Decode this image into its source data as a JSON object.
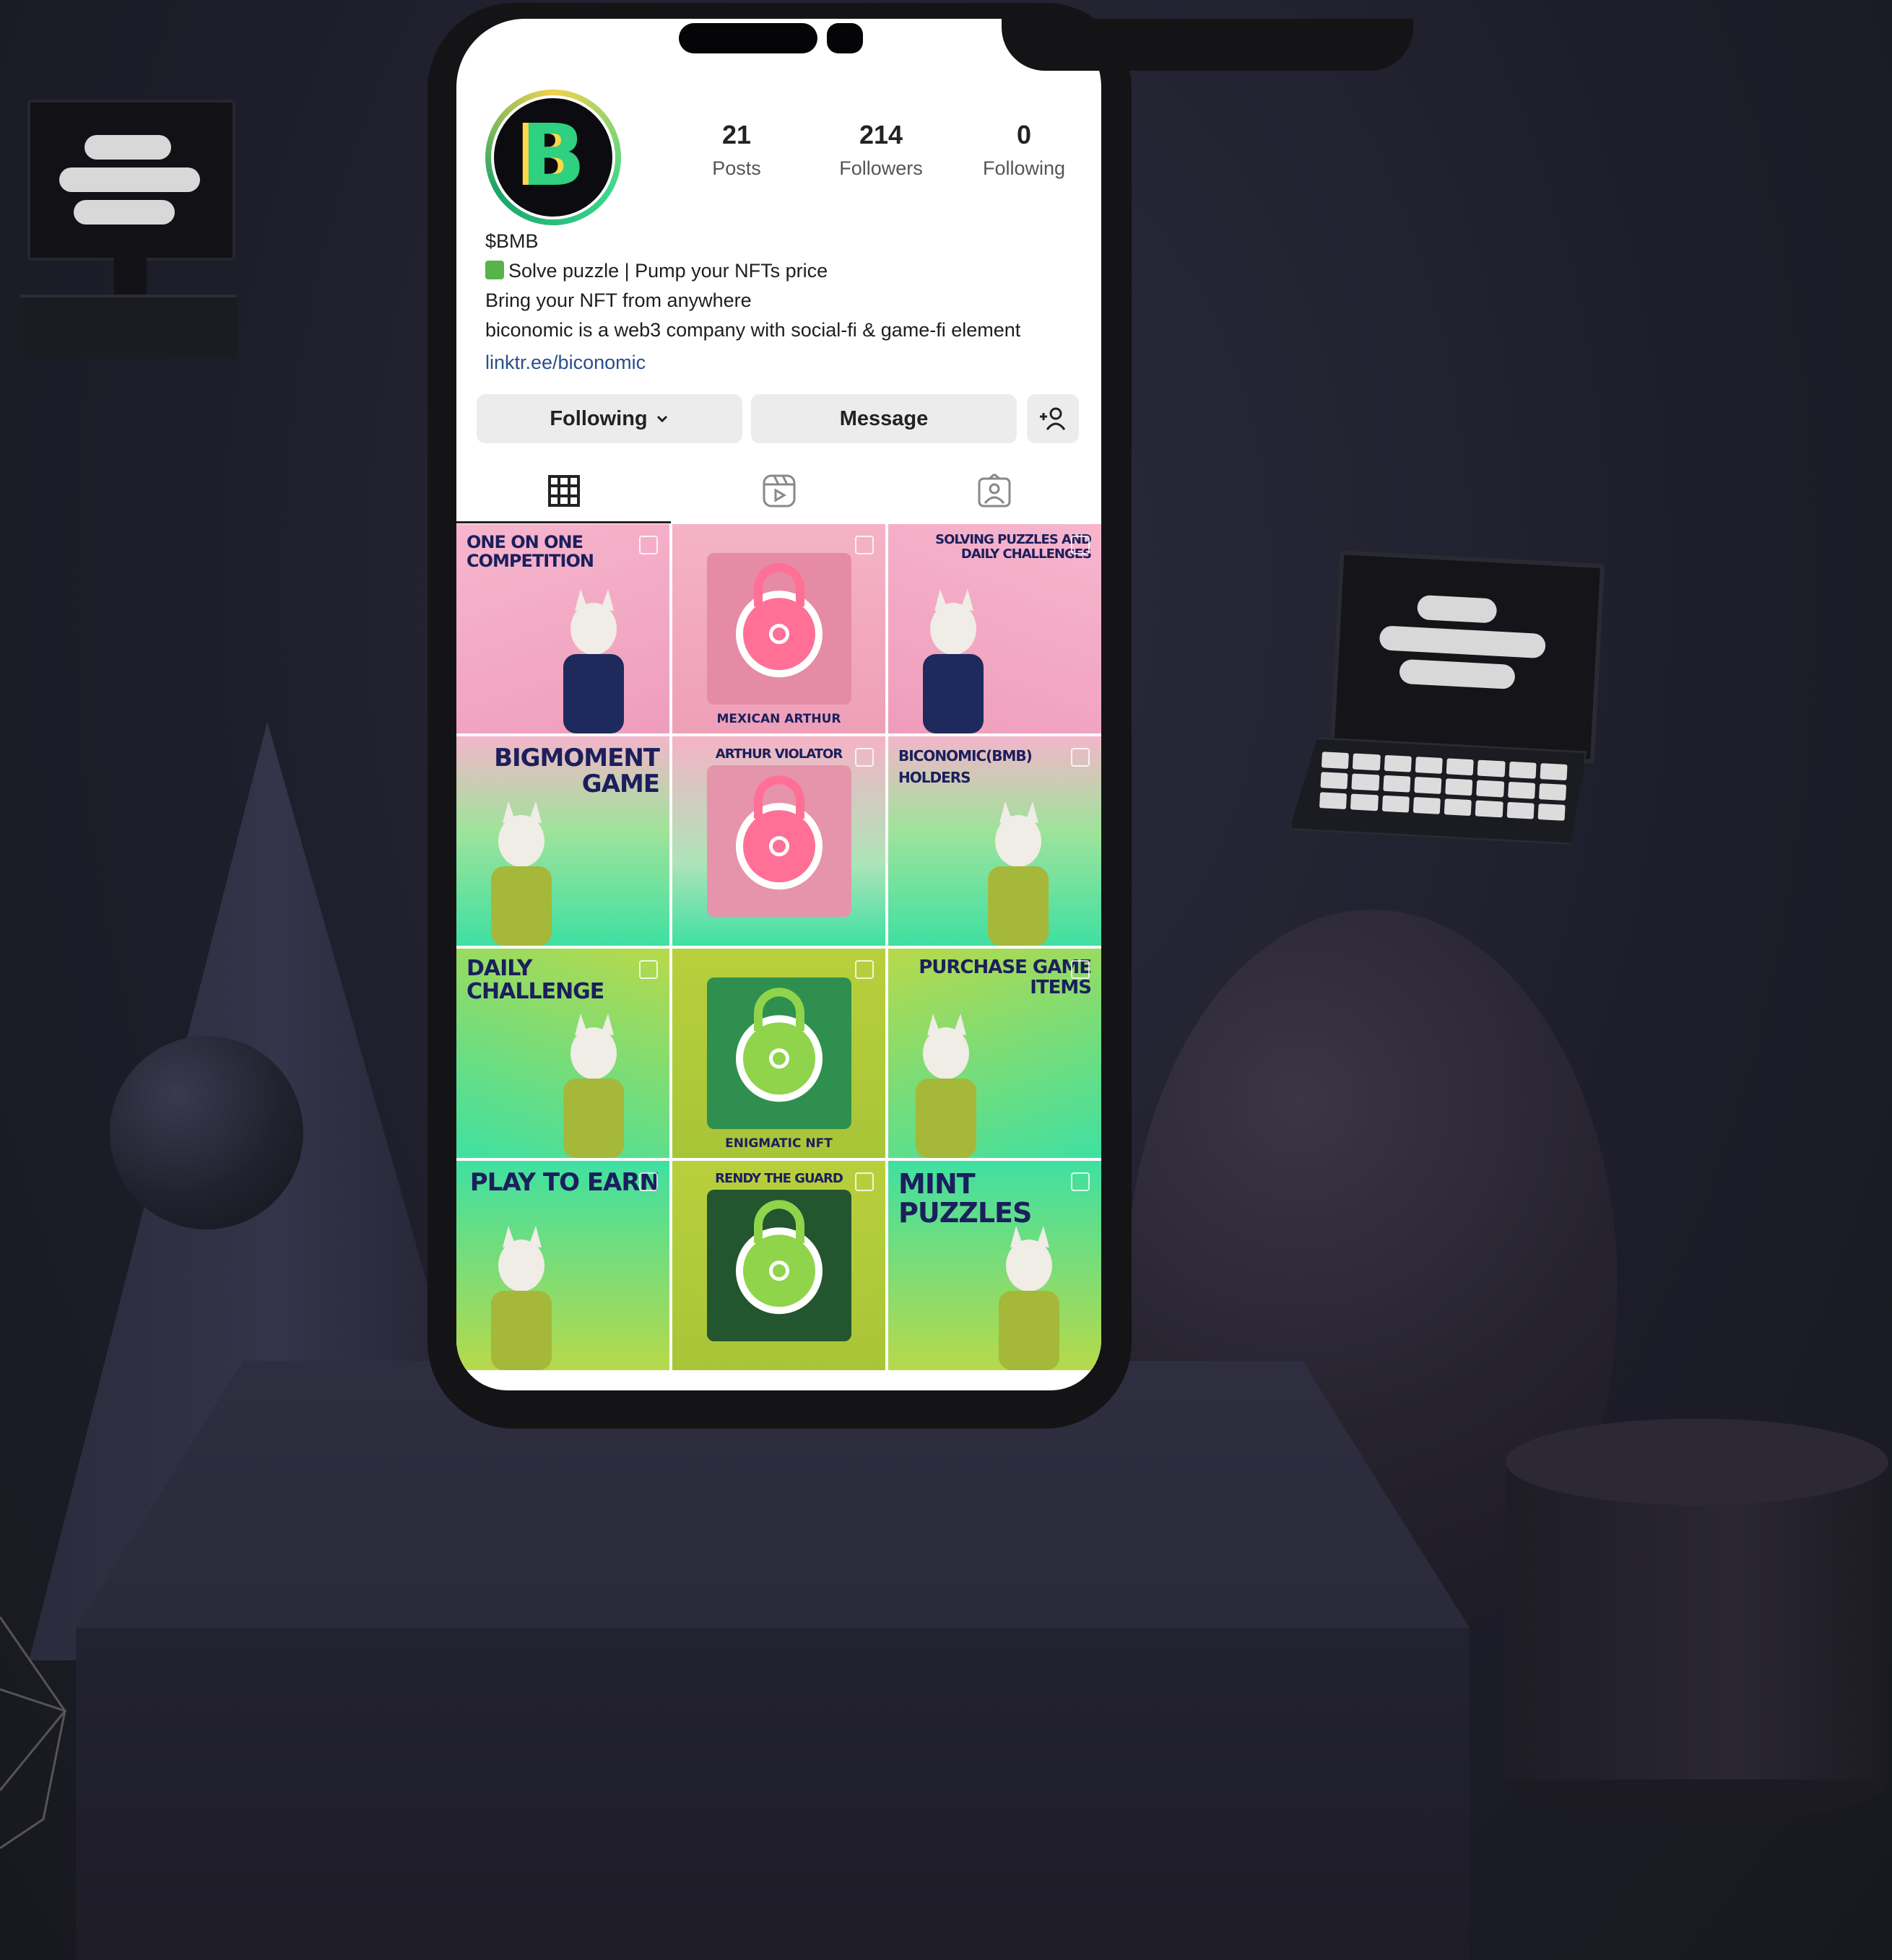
{
  "profile": {
    "username": "$BMB",
    "avatar_letter": "B",
    "stats": [
      {
        "value": "21",
        "label": "Posts"
      },
      {
        "value": "214",
        "label": "Followers"
      },
      {
        "value": "0",
        "label": "Following"
      }
    ],
    "bio_line1": "Solve puzzle | Pump your NFTs price",
    "bio_line2": "Bring your NFT from anywhere",
    "bio_line3": "biconomic is a web3 company with social-fi & game-fi element",
    "link": "linktr.ee/biconomic"
  },
  "actions": {
    "following_label": "Following",
    "message_label": "Message",
    "add_person_icon": "add-person-icon"
  },
  "tabs": [
    {
      "icon": "grid-icon",
      "active": true
    },
    {
      "icon": "reels-icon",
      "active": false
    },
    {
      "icon": "tagged-icon",
      "active": false
    }
  ],
  "posts": [
    {
      "title": "ONE ON ONE COMPETITION",
      "caption": "",
      "theme": "pink"
    },
    {
      "title": "",
      "caption": "MEXICAN ARTHUR",
      "theme": "pink-lock"
    },
    {
      "title": "SOLVING PUZZLES AND DAILY CHALLENGES",
      "caption": "",
      "theme": "pink"
    },
    {
      "title": "BIGMOMENT GAME",
      "caption": "",
      "theme": "pink-green"
    },
    {
      "title": "ARTHUR VIOLATOR",
      "caption": "",
      "theme": "pink-green-lock"
    },
    {
      "title": "BICONOMIC(BMB) HOLDERS",
      "caption": "",
      "theme": "pink-green"
    },
    {
      "title": "DAILY CHALLENGE",
      "caption": "",
      "theme": "green"
    },
    {
      "title": "",
      "caption": "ENIGMATIC NFT",
      "theme": "green-lock"
    },
    {
      "title": "PURCHASE GAME ITEMS",
      "caption": "",
      "theme": "green"
    },
    {
      "title": "PLAY TO EARN",
      "caption": "",
      "theme": "green"
    },
    {
      "title": "RENDY THE GUARD",
      "caption": "",
      "theme": "green-lock"
    },
    {
      "title": "MINT PUZZLES",
      "caption": "",
      "theme": "green"
    }
  ],
  "colors": {
    "pink": "#f3a9c4",
    "green": "#3fe0a2",
    "lime": "#b8d94a",
    "link": "#2a4e8c",
    "lock_pink": "#ff6f96",
    "lock_green": "#8fd44a",
    "background": "#1e1e2b"
  }
}
